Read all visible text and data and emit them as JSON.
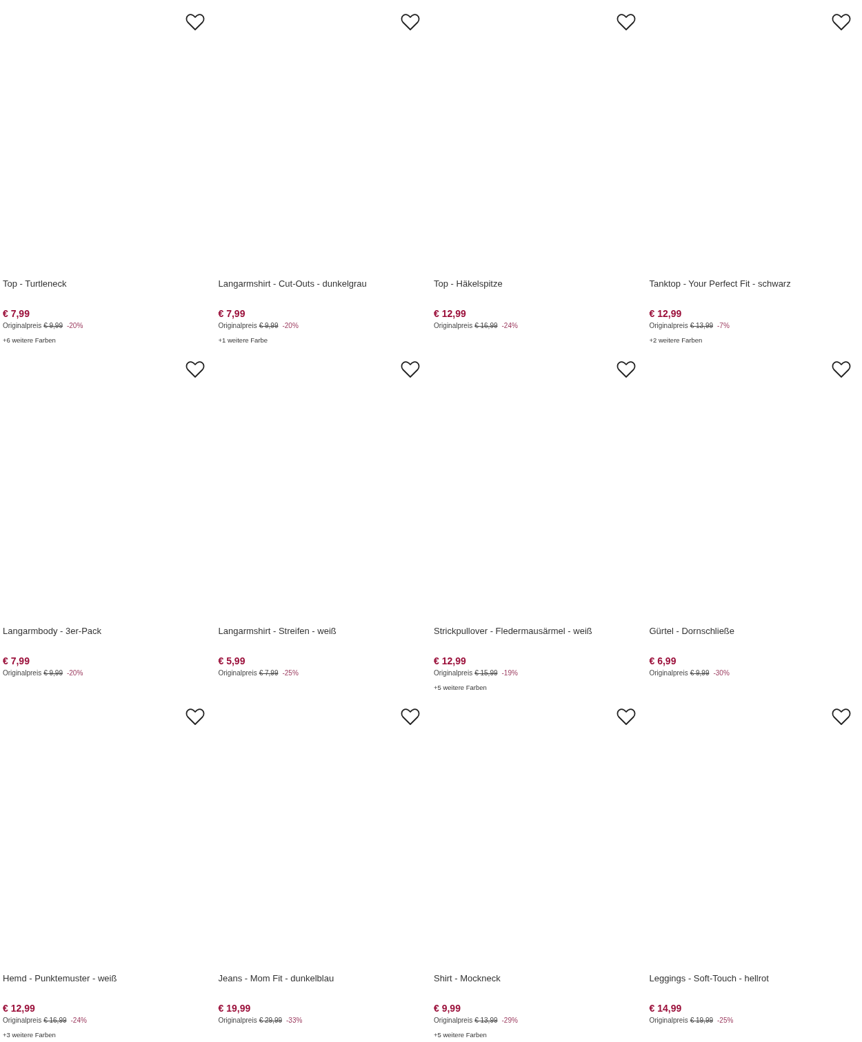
{
  "products": [
    {
      "title": "Top - Turtleneck",
      "price": "€ 7,99",
      "original_label": "Originalpreis",
      "original_price": "€ 9,99",
      "discount": "-20%",
      "more_colors": "+6 weitere Farben"
    },
    {
      "title": "Langarmshirt - Cut-Outs - dunkelgrau",
      "price": "€ 7,99",
      "original_label": "Originalpreis",
      "original_price": "€ 9,99",
      "discount": "-20%",
      "more_colors": "+1 weitere Farbe"
    },
    {
      "title": "Top - Häkelspitze",
      "price": "€ 12,99",
      "original_label": "Originalpreis",
      "original_price": "€ 16,99",
      "discount": "-24%"
    },
    {
      "title": "Tanktop - Your Perfect Fit - schwarz",
      "price": "€ 12,99",
      "original_label": "Originalpreis",
      "original_price": "€ 13,99",
      "discount": "-7%",
      "more_colors": "+2 weitere Farben"
    },
    {
      "title": "Langarmbody - 3er-Pack",
      "price": "€ 7,99",
      "original_label": "Originalpreis",
      "original_price": "€ 9,99",
      "discount": "-20%"
    },
    {
      "title": "Langarmshirt - Streifen - weiß",
      "price": "€ 5,99",
      "original_label": "Originalpreis",
      "original_price": "€ 7,99",
      "discount": "-25%"
    },
    {
      "title": "Strickpullover - Fledermausärmel - weiß",
      "price": "€ 12,99",
      "original_label": "Originalpreis",
      "original_price": "€ 15,99",
      "discount": "-19%",
      "more_colors": "+5 weitere Farben"
    },
    {
      "title": "Gürtel - Dornschließe",
      "price": "€ 6,99",
      "original_label": "Originalpreis",
      "original_price": "€ 9,99",
      "discount": "-30%"
    },
    {
      "title": "Hemd - Punktemuster - weiß",
      "price": "€ 12,99",
      "original_label": "Originalpreis",
      "original_price": "€ 16,99",
      "discount": "-24%",
      "more_colors": "+3 weitere Farben"
    },
    {
      "title": "Jeans - Mom Fit - dunkelblau",
      "price": "€ 19,99",
      "original_label": "Originalpreis",
      "original_price": "€ 29,99",
      "discount": "-33%"
    },
    {
      "title": "Shirt - Mockneck",
      "price": "€ 9,99",
      "original_label": "Originalpreis",
      "original_price": "€ 13,99",
      "discount": "-29%",
      "more_colors": "+5 weitere Farben"
    },
    {
      "title": "Leggings - Soft-Touch - hellrot",
      "price": "€ 14,99",
      "original_label": "Originalpreis",
      "original_price": "€ 19,99",
      "discount": "-25%"
    }
  ]
}
